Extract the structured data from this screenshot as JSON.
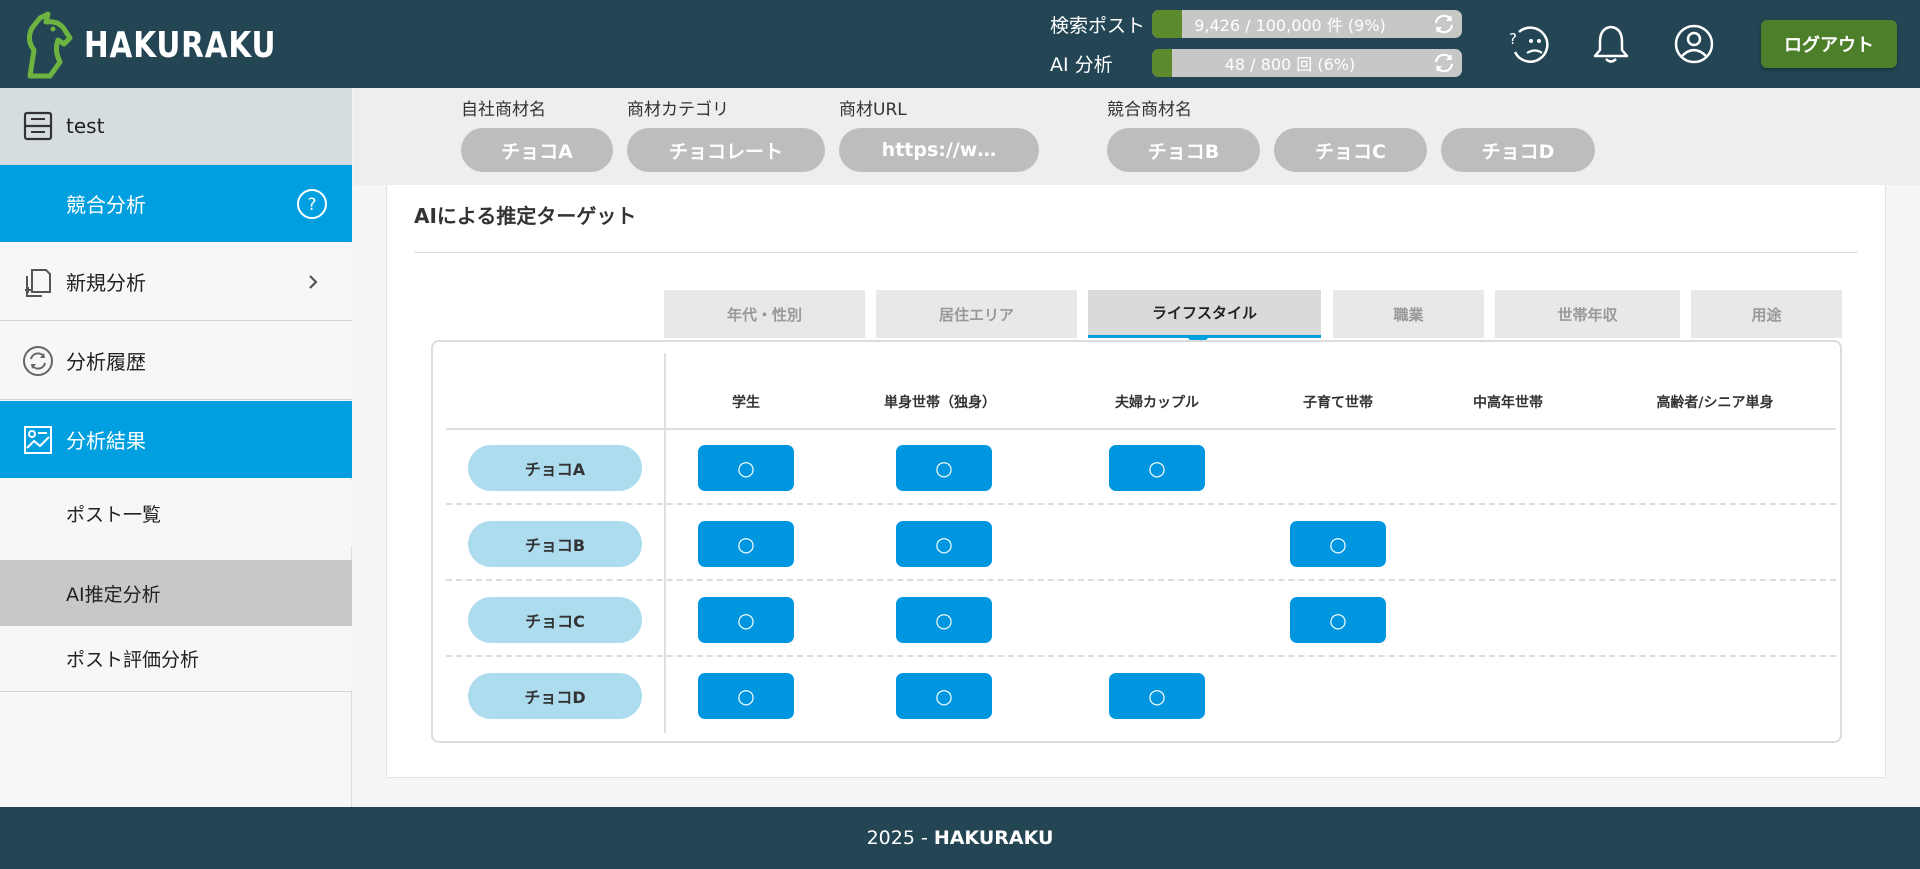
{
  "header": {
    "brand": "HAKURAKU",
    "quota": [
      {
        "label": "検索ポスト",
        "text": "9,426 / 100,000 件 (9%)",
        "percent": 9
      },
      {
        "label": "AI 分析",
        "text": "48 / 800 回 (6%)",
        "percent": 6
      }
    ],
    "logout_label": "ログアウト"
  },
  "sidebar": {
    "project": "test",
    "items": [
      {
        "label": "競合分析"
      },
      {
        "label": "新規分析"
      },
      {
        "label": "分析履歴"
      },
      {
        "label": "分析結果"
      }
    ],
    "sub_items": [
      {
        "label": "ポスト一覧"
      },
      {
        "label": "AI推定分析"
      },
      {
        "label": "ポスト評価分析"
      }
    ]
  },
  "filters": {
    "own_product_label": "自社商材名",
    "own_product": "チョコA",
    "category_label": "商材カテゴリ",
    "category": "チョコレート",
    "url_label": "商材URL",
    "url": "https://w…",
    "competitor_label": "競合商材名",
    "competitors": [
      "チョコB",
      "チョコC",
      "チョコD"
    ]
  },
  "card": {
    "title": "AIによる推定ターゲット",
    "tabs": [
      "年代・性別",
      "居住エリア",
      "ライフスタイル",
      "職業",
      "世帯年収",
      "用途"
    ],
    "active_tab": "ライフスタイル",
    "columns": [
      "学生",
      "単身世帯（独身）",
      "夫婦カップル",
      "子育て世帯",
      "中高年世帯",
      "高齢者/シニア単身"
    ],
    "rows": [
      {
        "name": "チョコA",
        "marks": [
          true,
          true,
          true,
          false,
          false,
          false
        ]
      },
      {
        "name": "チョコB",
        "marks": [
          true,
          true,
          false,
          true,
          false,
          false
        ]
      },
      {
        "name": "チョコC",
        "marks": [
          true,
          true,
          false,
          true,
          false,
          false
        ]
      },
      {
        "name": "チョコD",
        "marks": [
          true,
          true,
          true,
          false,
          false,
          false
        ]
      }
    ],
    "mark_symbol": "○"
  },
  "footer": {
    "year": "2025 -",
    "brand": "HAKURAKU"
  }
}
